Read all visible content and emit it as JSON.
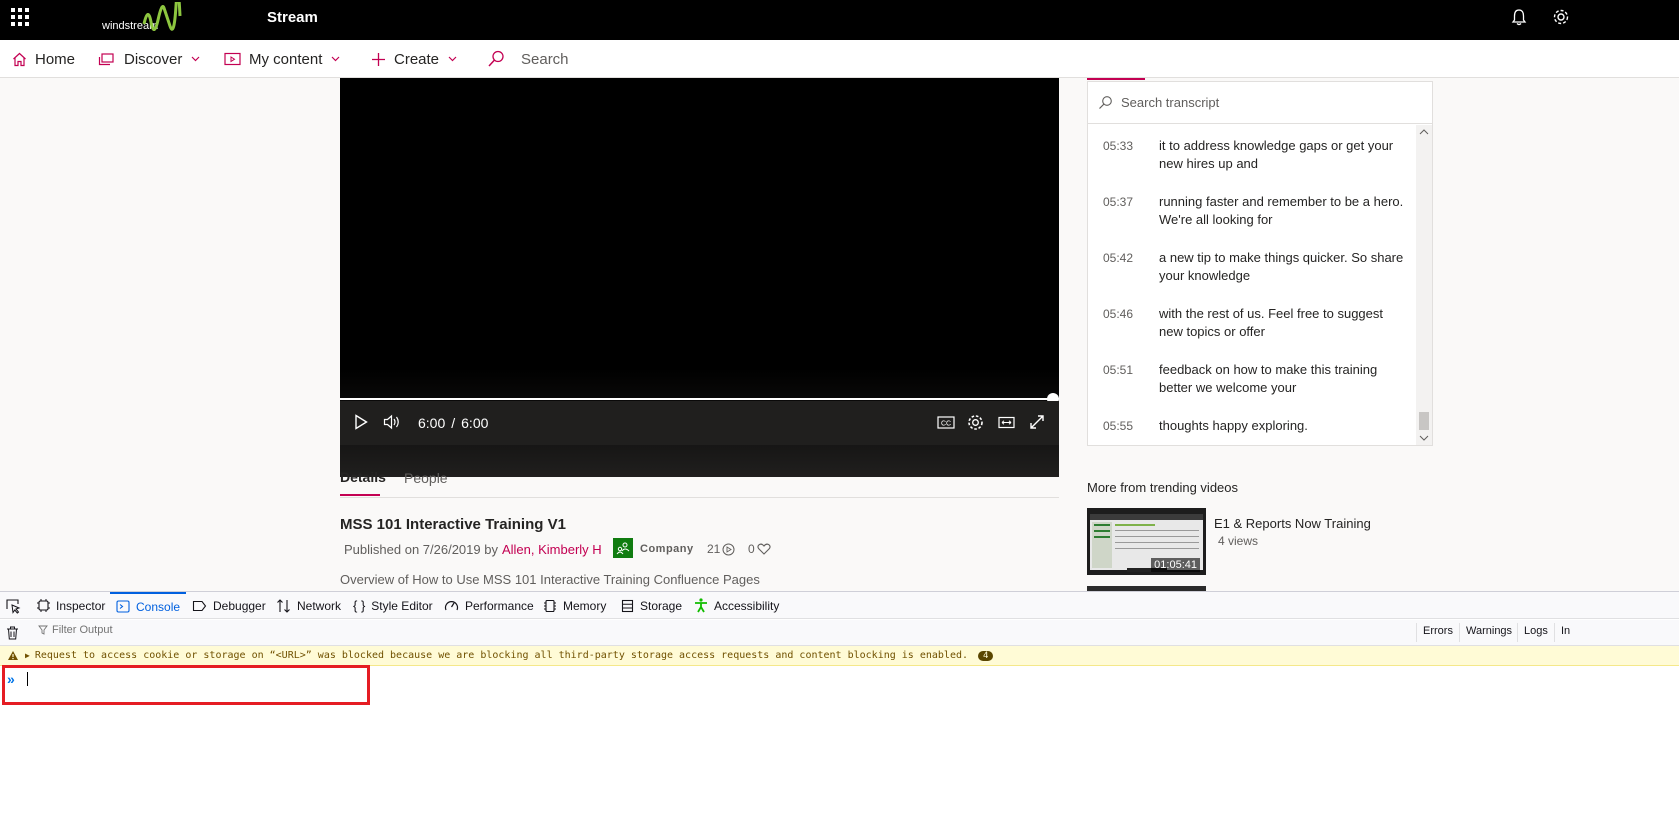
{
  "topbar": {
    "brand_text": "windstream",
    "app_title": "Stream"
  },
  "nav": {
    "home": "Home",
    "discover": "Discover",
    "my_content": "My content",
    "create": "Create",
    "search_placeholder": "Search"
  },
  "player": {
    "current_time": "6:00",
    "separator": "/",
    "duration": "6:00",
    "progress": 1.0
  },
  "details": {
    "tabs": [
      "Details",
      "People"
    ],
    "title": "MSS 101 Interactive Training V1",
    "published": "Published on 7/26/2019 by",
    "author": "Allen, Kimberly H",
    "company": "Company",
    "views": "21",
    "likes": "0",
    "description": "Overview of How to Use MSS 101 Interactive Training Confluence Pages"
  },
  "transcript": {
    "search_placeholder": "Search transcript",
    "rows": [
      {
        "time": "05:33",
        "text": "it to address knowledge gaps or get your new hires up and"
      },
      {
        "time": "05:37",
        "text": "running faster and remember to be a hero. We're all looking for"
      },
      {
        "time": "05:42",
        "text": "a new tip to make things quicker. So share your knowledge"
      },
      {
        "time": "05:46",
        "text": "with the rest of us. Feel free to suggest new topics or offer"
      },
      {
        "time": "05:51",
        "text": "feedback on how to make this training better we welcome your"
      },
      {
        "time": "05:55",
        "text": "thoughts happy exploring."
      }
    ]
  },
  "trending": {
    "heading": "More from trending videos",
    "items": [
      {
        "title": "E1 & Reports Now Training",
        "views": "4 views",
        "duration": "01:05:41"
      }
    ]
  },
  "devtools": {
    "tabs": [
      "Inspector",
      "Console",
      "Debugger",
      "Network",
      "Style Editor",
      "Performance",
      "Memory",
      "Storage",
      "Accessibility"
    ],
    "active_tab": "Console",
    "filter_placeholder": "Filter Output",
    "filter_buttons": [
      "Errors",
      "Warnings",
      "Logs",
      "In"
    ],
    "warning_text": "Request to access cookie or storage on “<URL>” was blocked because we are blocking all third-party storage access requests and content blocking is enabled.",
    "warning_count": "4",
    "prompt_symbol": "»"
  },
  "colors": {
    "accent": "#c30052",
    "devtools_blue": "#0060df",
    "highlight_box": "#e51d23",
    "brand_green": "#8dc63f"
  }
}
